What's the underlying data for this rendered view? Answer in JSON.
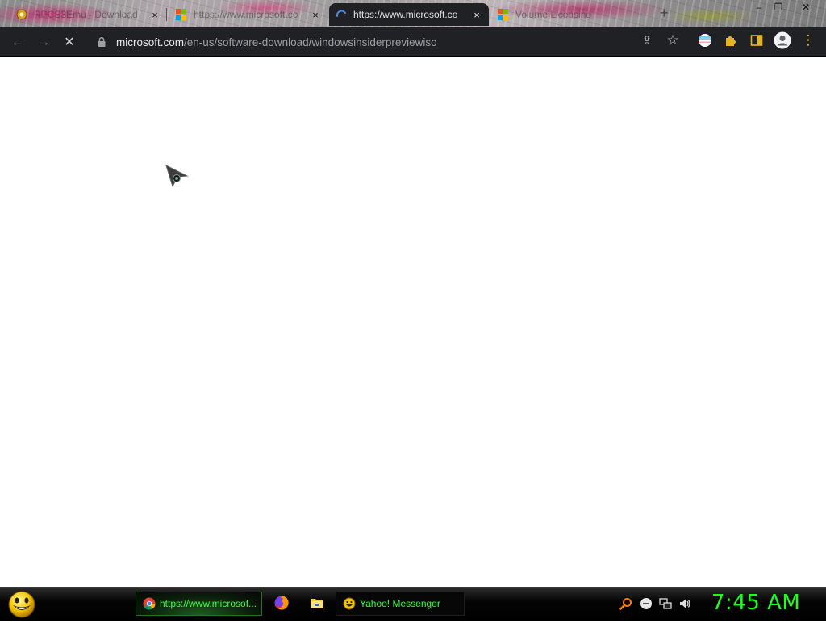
{
  "browser": {
    "tabs": [
      {
        "title": "RPCS3Emu - Download",
        "icon": "rpcs3-favicon",
        "close": "×",
        "active": false
      },
      {
        "title": "https://www.microsoft.co",
        "icon": "microsoft-logo",
        "close": "×",
        "active": false
      },
      {
        "title": "https://www.microsoft.co",
        "icon": "loading-spinner",
        "close": "×",
        "active": true
      },
      {
        "title": "Volume Licensing",
        "icon": "microsoft-logo",
        "close": "",
        "active": false
      }
    ],
    "new_tab_label": "+",
    "window_controls": {
      "minimize": "–",
      "maximize": "❐",
      "close": "✕"
    },
    "toolbar": {
      "back_icon": "←",
      "forward_icon": "→",
      "stop_icon": "✕",
      "url_host": "microsoft.com",
      "url_path": "/en-us/software-download/windowsinsiderpreviewiso",
      "share_icon": "⇪",
      "bookmark_icon": "☆",
      "menu_icon": "⋮"
    }
  },
  "colors": {
    "toolbar_bg": "#202124",
    "taskbar_text": "#3cff3c",
    "clock": "#1dff1d",
    "loading_blue": "#4d8ce8"
  },
  "taskbar": {
    "items": [
      {
        "label": "https://www.microsof...",
        "icon": "chrome-icon",
        "active": true
      },
      {
        "label": "",
        "icon": "firefox-icon"
      },
      {
        "label": "",
        "icon": "file-explorer-icon"
      },
      {
        "label": "Yahoo! Messenger",
        "icon": "yahoo-messenger-icon",
        "active": false
      }
    ],
    "tray_icons": [
      "search-icon",
      "minus-circle-icon",
      "network-icon",
      "volume-icon"
    ],
    "clock": "7:45 AM"
  }
}
